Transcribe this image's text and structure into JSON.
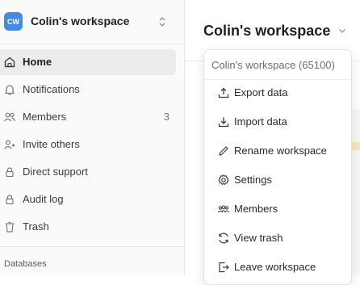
{
  "sidebar": {
    "workspace": {
      "initials": "CW",
      "name": "Colin's workspace",
      "avatar_color": "#3f8ce8"
    },
    "nav": [
      {
        "label": "Home",
        "icon": "home-icon",
        "active": true
      },
      {
        "label": "Notifications",
        "icon": "bell-icon"
      },
      {
        "label": "Members",
        "icon": "members-icon",
        "count": "3"
      },
      {
        "label": "Invite others",
        "icon": "user-plus-icon"
      },
      {
        "label": "Direct support",
        "icon": "lock-icon"
      },
      {
        "label": "Audit log",
        "icon": "lock-icon"
      },
      {
        "label": "Trash",
        "icon": "trash-icon"
      }
    ],
    "section_label": "Databases"
  },
  "main": {
    "title": "Colin's workspace"
  },
  "dropdown": {
    "header": "Colin's workspace (65100)",
    "items": [
      {
        "label": "Export data",
        "icon": "export-icon"
      },
      {
        "label": "Import data",
        "icon": "import-icon"
      },
      {
        "label": "Rename workspace",
        "icon": "pencil-icon"
      },
      {
        "label": "Settings",
        "icon": "gear-icon"
      },
      {
        "label": "Members",
        "icon": "members-icon"
      },
      {
        "label": "View trash",
        "icon": "refresh-icon"
      },
      {
        "label": "Leave workspace",
        "icon": "leave-icon"
      }
    ]
  }
}
